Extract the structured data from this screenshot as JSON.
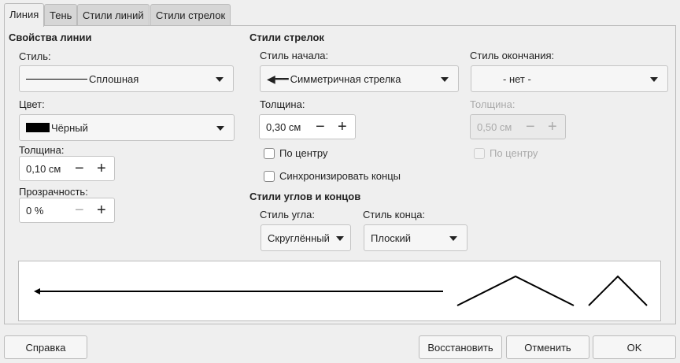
{
  "tabs": [
    "Линия",
    "Тень",
    "Стили линий",
    "Стили стрелок"
  ],
  "line_props": {
    "title": "Свойства линии",
    "style_label": "Стиль:",
    "style_value": "Сплошная",
    "color_label": "Цвет:",
    "color_value": "Чёрный",
    "color_hex": "#000000",
    "width_label": "Толщина:",
    "width_value": "0,10 см",
    "transparency_label": "Прозрачность:",
    "transparency_value": "0 %"
  },
  "arrow_styles": {
    "title": "Стили стрелок",
    "start_label": "Стиль начала:",
    "start_value": "Симметричная стрелка",
    "end_label": "Стиль окончания:",
    "end_value": "- нет -",
    "start_width_label": "Толщина:",
    "start_width_value": "0,30 см",
    "end_width_label": "Толщина:",
    "end_width_value": "0,50 см",
    "start_center": "По центру",
    "end_center": "По центру",
    "sync": "Синхронизировать концы"
  },
  "corner_styles": {
    "title": "Стили углов и концов",
    "corner_label": "Стиль угла:",
    "corner_value": "Скруглённый",
    "cap_label": "Стиль конца:",
    "cap_value": "Плоский"
  },
  "buttons": {
    "help": "Справка",
    "reset": "Восстановить",
    "cancel": "Отменить",
    "ok": "OK"
  }
}
